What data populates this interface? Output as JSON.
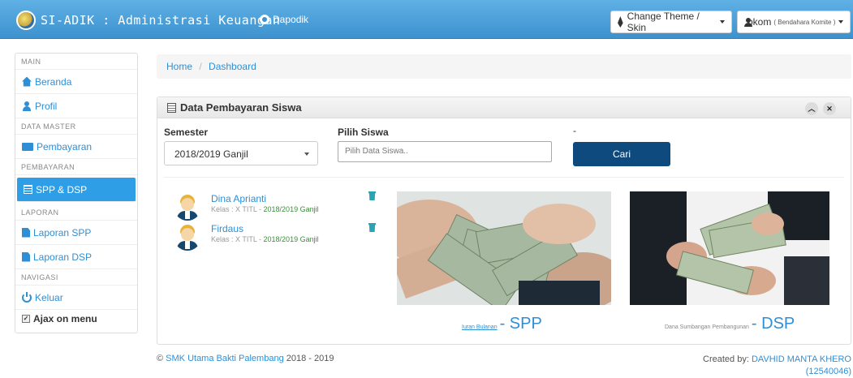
{
  "app": {
    "title": "SI-ADIK : Administrasi Keuangan",
    "dapodik_label": "Dapodik"
  },
  "navbar": {
    "theme_label": "Change Theme / Skin",
    "user_name": "bkom",
    "user_role": "( Bendahara Komite )"
  },
  "sidebar": {
    "sections": {
      "main": "MAIN",
      "data_master": "DATA MASTER",
      "pembayaran": "PEMBAYARAN",
      "laporan": "LAPORAN",
      "navigasi": "NAVIGASI"
    },
    "items": {
      "beranda": "Beranda",
      "profil": "Profil",
      "pembayaran": "Pembayaran",
      "spp_dsp": "SPP & DSP",
      "laporan_spp": "Laporan SPP",
      "laporan_dsp": "Laporan DSP",
      "keluar": "Keluar"
    },
    "ajax_label": "Ajax on menu"
  },
  "breadcrumb": {
    "home": "Home",
    "separator": "/",
    "current": "Dashboard"
  },
  "panel": {
    "title": "Data Pembayaran Siswa",
    "semester_label": "Semester",
    "semester_value": "2018/2019 Ganjil",
    "siswa_label": "Pilih Siswa",
    "siswa_placeholder": "Pilih Data Siswa..",
    "dash_label": "-",
    "search_button": "Cari",
    "students": [
      {
        "name": "Dina Aprianti",
        "kelas": "Kelas : X TITL - ",
        "semester": "2018/2019 Ganjil"
      },
      {
        "name": "Firdaus",
        "kelas": "Kelas : X TITL - ",
        "semester": "2018/2019 Ganjil"
      }
    ],
    "cards": [
      {
        "caption_small": "Iuran Bulanan",
        "caption_big": " - SPP"
      },
      {
        "caption_small": "Dana Sumbangan Pembangunan",
        "caption_big": " - DSP"
      }
    ]
  },
  "footer": {
    "school": "SMK Utama Bakti Palembang",
    "years": " 2018 - 2019",
    "created_prefix": "Created by: ",
    "author": "DAVHID MANTA KHERO",
    "author_id": "(12540046)",
    "copyright": "©"
  },
  "colors": {
    "navbar": "#3d92cf",
    "accent": "#2e8fd6",
    "button_dark": "#0e4a7e",
    "active_item": "#2e9fe6"
  }
}
